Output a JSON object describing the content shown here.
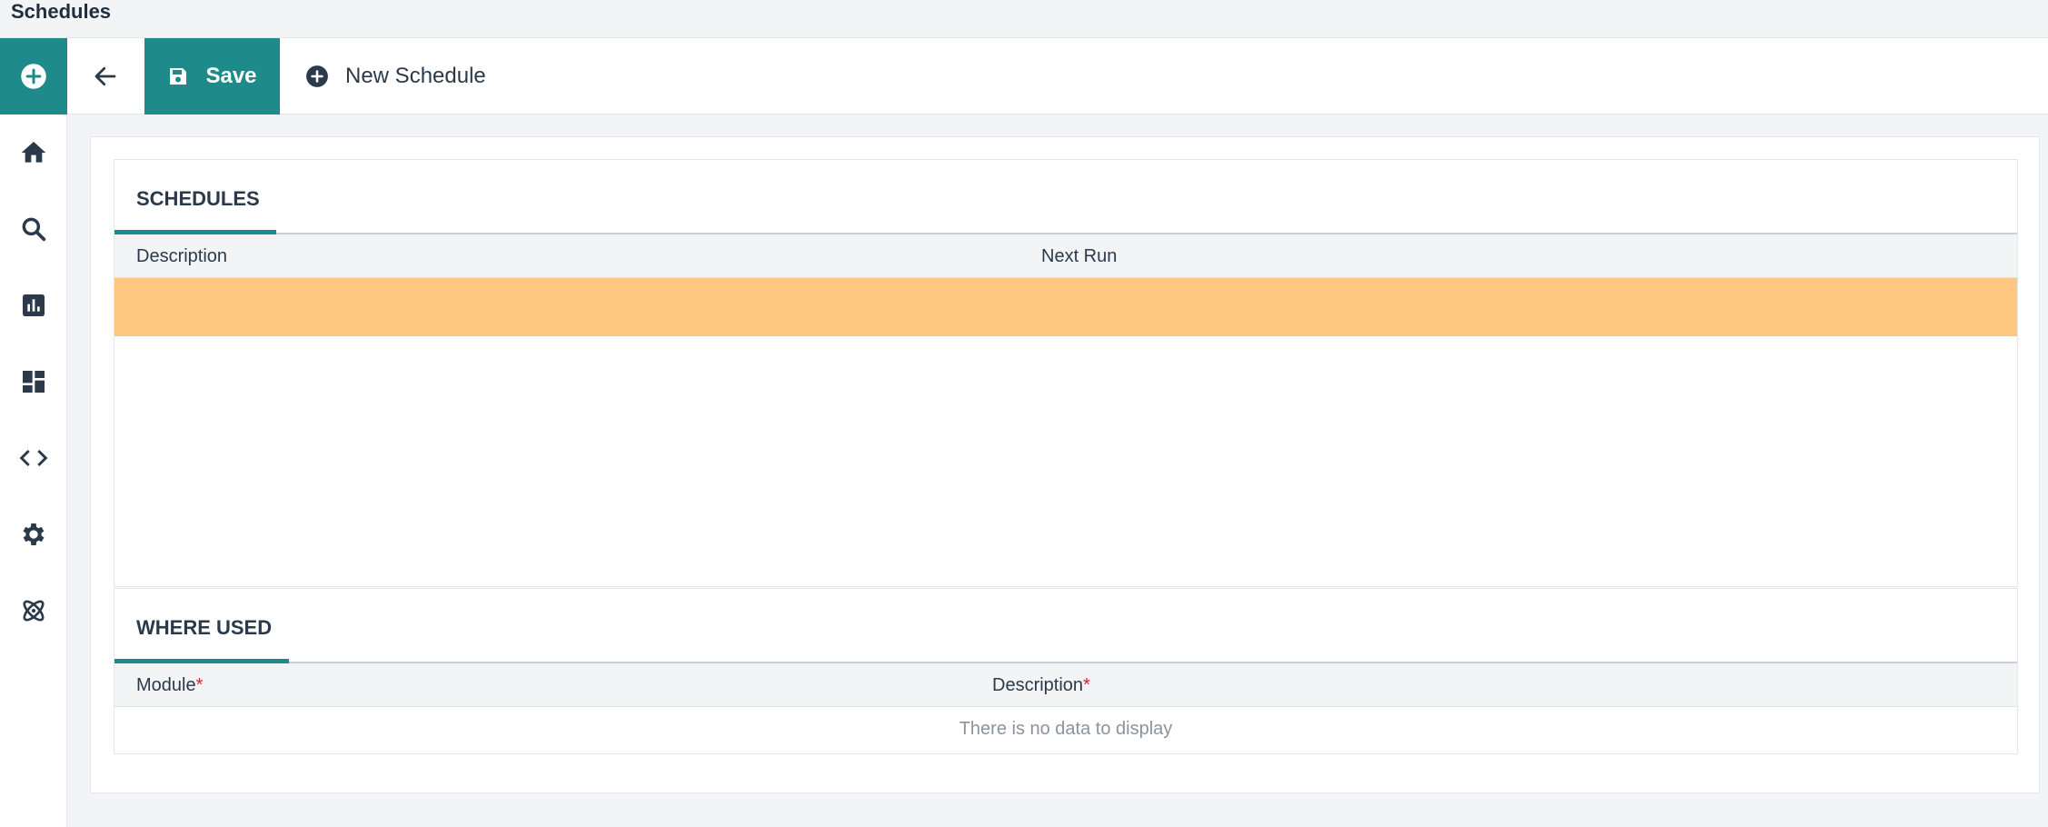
{
  "window": {
    "title": "Schedules"
  },
  "sidebar": {
    "add_icon": "plus-circle-icon",
    "items": [
      {
        "icon": "home-icon"
      },
      {
        "icon": "search-icon"
      },
      {
        "icon": "chart-icon"
      },
      {
        "icon": "dashboard-icon"
      },
      {
        "icon": "code-icon"
      },
      {
        "icon": "gear-icon"
      },
      {
        "icon": "atom-icon"
      }
    ]
  },
  "toolbar": {
    "back_icon": "arrow-left-icon",
    "save_label": "Save",
    "save_icon": "floppy-disk-icon",
    "new_label": "New Schedule",
    "new_icon": "plus-circle-icon"
  },
  "schedules": {
    "heading": "SCHEDULES",
    "columns": [
      "Description",
      "Next Run"
    ],
    "rows": [
      {
        "description": "",
        "next_run": "",
        "selected": true
      }
    ]
  },
  "where_used": {
    "heading": "WHERE USED",
    "columns": [
      "Module",
      "Description"
    ],
    "required_marker": "*",
    "empty_text": "There is no data to display"
  },
  "colors": {
    "accent": "#1e8a8a",
    "selected_row": "#ffc780",
    "required": "#e0202a"
  }
}
